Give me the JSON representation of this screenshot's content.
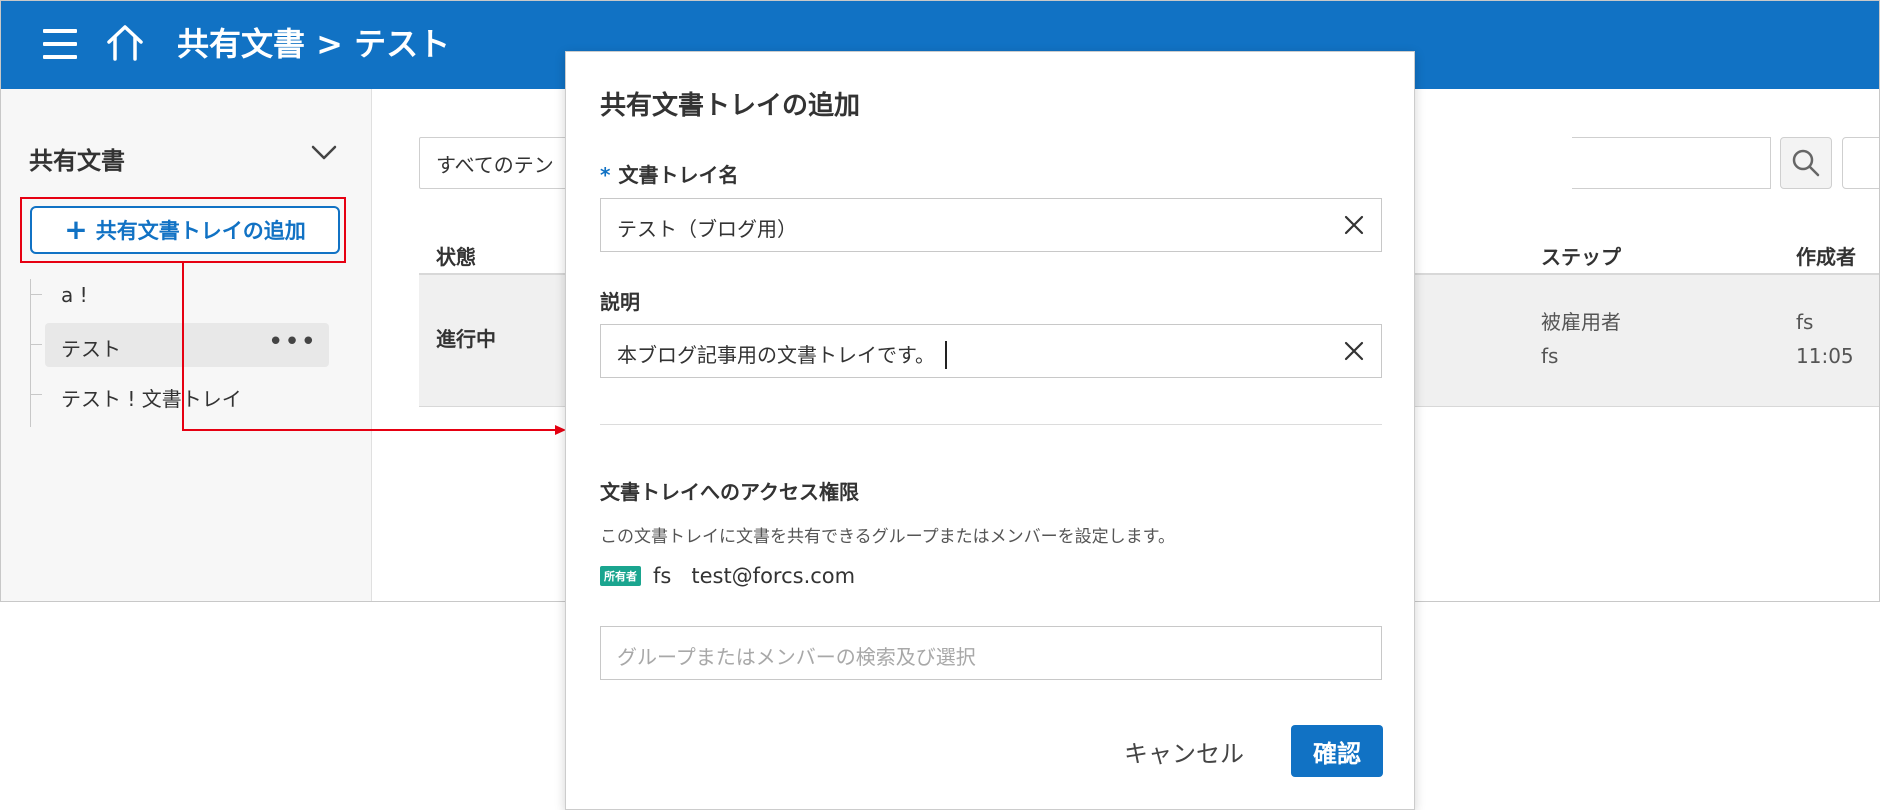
{
  "header": {
    "title": "共有文書 > テスト",
    "background_color": "#1172c4"
  },
  "sidebar": {
    "header": "共有文書",
    "add_button_label": "共有文書トレイの追加",
    "tree_items": [
      {
        "label": "a !"
      },
      {
        "label": "テスト",
        "active": true
      },
      {
        "label": "テスト ! 文書トレイ"
      }
    ]
  },
  "main": {
    "filter_select_value": "すべてのテン",
    "table_headers": {
      "status": "状態",
      "step": "ステップ",
      "creator": "作成者"
    },
    "rows": [
      {
        "status": "進行中",
        "step_line1": "被雇用者",
        "step_line2": "fs",
        "creator_line1": "fs",
        "creator_line2": "11:05"
      }
    ]
  },
  "dialog": {
    "title": "共有文書トレイの追加",
    "required_mark": "*",
    "name_label": "文書トレイ名",
    "name_value": "テスト（ブログ用）",
    "description_label": "説明",
    "description_value": "本ブログ記事用の文書トレイです。",
    "access_title": "文書トレイへのアクセス権限",
    "access_description": "この文書トレイに文書を共有できるグループまたはメンバーを設定します。",
    "owner": {
      "badge": "所有者",
      "name": "fs",
      "email": "test@forcs.com"
    },
    "member_search_placeholder": "グループまたはメンバーの検索及び選択",
    "cancel_label": "キャンセル",
    "confirm_label": "確認"
  },
  "colors": {
    "accent": "#1172c4",
    "highlight": "#e60012",
    "owner_badge": "#1aa58f"
  }
}
